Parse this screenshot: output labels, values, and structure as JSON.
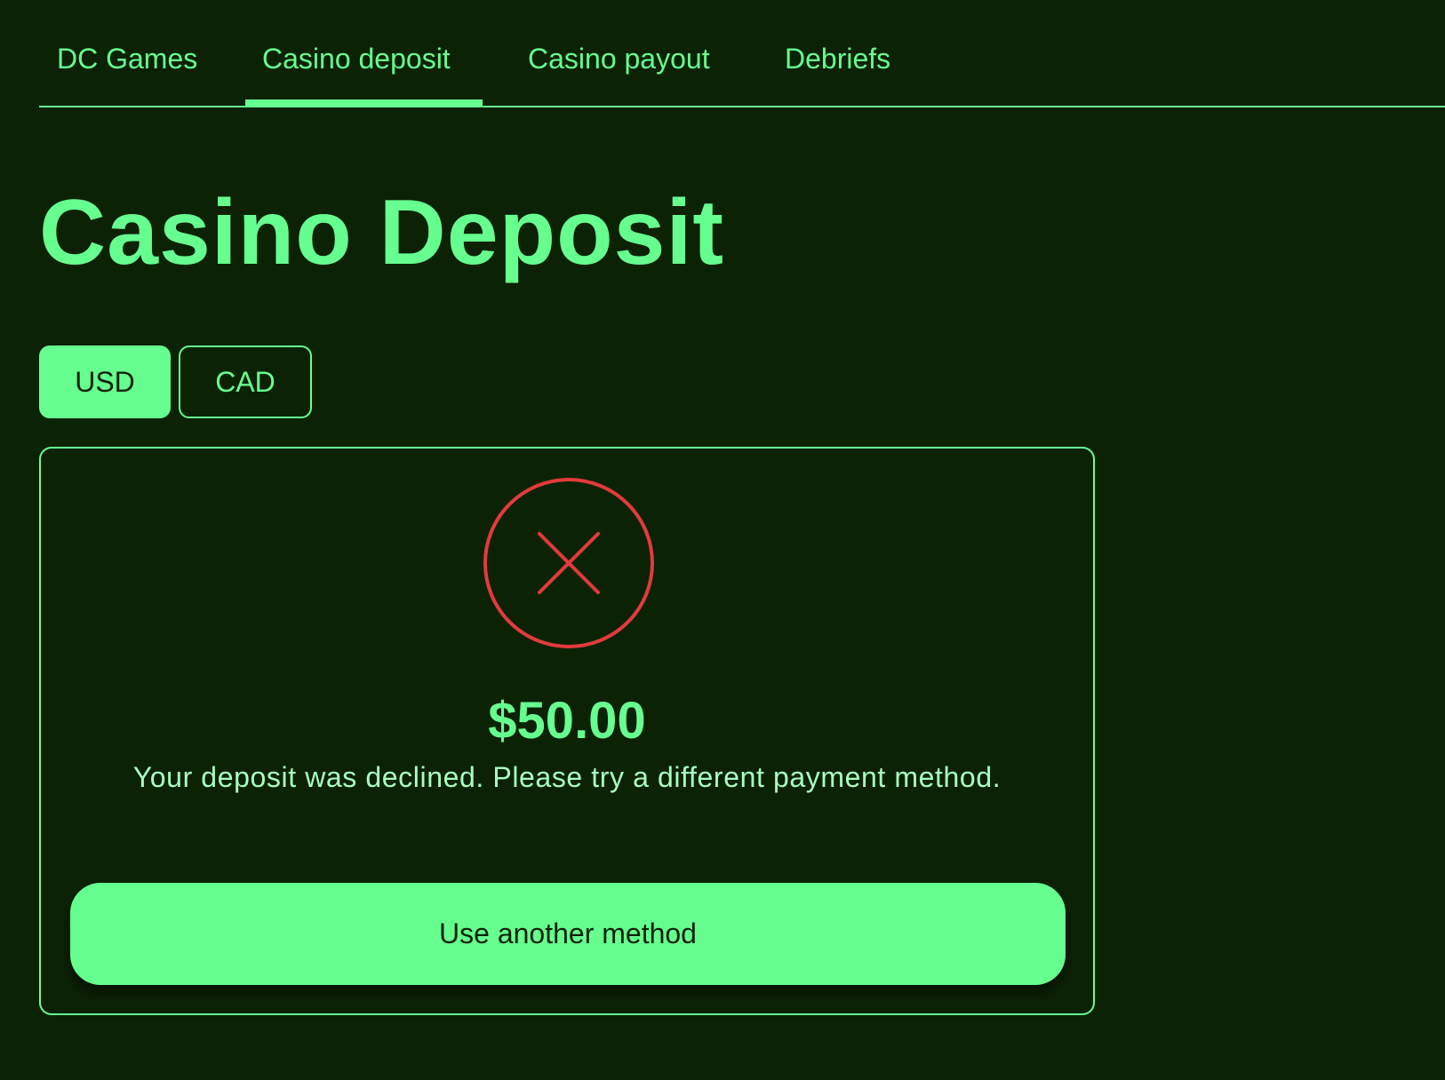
{
  "nav": {
    "tabs": [
      {
        "label": "DC Games"
      },
      {
        "label": "Casino deposit",
        "active": true
      },
      {
        "label": "Casino payout"
      },
      {
        "label": "Debriefs"
      }
    ]
  },
  "page": {
    "title": "Casino Deposit"
  },
  "currency": {
    "options": [
      "USD",
      "CAD"
    ],
    "selected": "USD"
  },
  "result": {
    "status_icon": "x-circle-icon",
    "amount": "$50.00",
    "message": "Your deposit was declined. Please try a different payment method.",
    "action_label": "Use another method"
  },
  "colors": {
    "background": "#0c2205",
    "accent": "#66ff8f",
    "error": "#e23b3b",
    "text_muted": "#a8ffbe"
  }
}
